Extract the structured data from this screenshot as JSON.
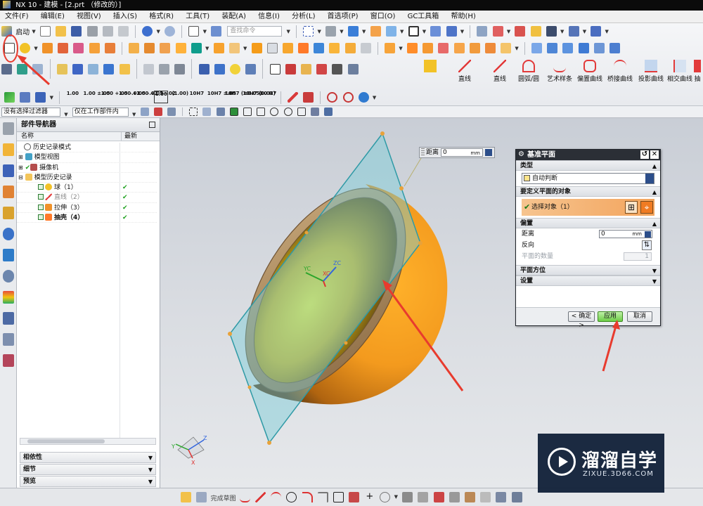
{
  "window": {
    "title": "NX 10 - 建模 - [2.prt （修改的）]"
  },
  "menubar": {
    "items": [
      "文件(F)",
      "编辑(E)",
      "视图(V)",
      "插入(S)",
      "格式(R)",
      "工具(T)",
      "装配(A)",
      "信息(I)",
      "分析(L)",
      "首选项(P)",
      "窗口(O)",
      "GC工具箱",
      "帮助(H)"
    ]
  },
  "toolbar": {
    "start_label": "启动",
    "search_placeholder": "查找命令",
    "curve_tools": [
      "直线",
      "直线",
      "圆弧/圆",
      "艺术样条",
      "偏置曲线",
      "桥接曲线",
      "投影曲线",
      "相交曲线",
      "抽"
    ],
    "unit_buttons": [
      "1.00",
      "1.00\n±.05",
      "1.00\n+.05\n-.02",
      "1.00\n+.05\n-.02",
      "1.00\n+.05\n-.02",
      "1.00",
      "(1.00)",
      "10H7",
      "10H7\n±.05",
      "10H7\n(±0.05)",
      "10H7\n(0.01)",
      "10\nH7"
    ]
  },
  "selection_bar": {
    "filter_value": "没有选择过滤器",
    "scope_value": "仅在工作部件内"
  },
  "part_navigator": {
    "title": "部件导航器",
    "col_name": "名称",
    "col_latest": "最新",
    "rows": [
      {
        "label": "历史记录模式",
        "check": false,
        "latest": ""
      },
      {
        "label": "模型视图",
        "check": false,
        "latest": ""
      },
      {
        "label": "摄像机",
        "check": true,
        "latest": ""
      },
      {
        "label": "模型历史记录",
        "check": false,
        "latest": ""
      },
      {
        "label": "球（1）",
        "check": true,
        "latest": "✔"
      },
      {
        "label": "直线（2）",
        "check": true,
        "latest": "✔"
      },
      {
        "label": "拉伸（3）",
        "check": true,
        "latest": "✔"
      },
      {
        "label": "抽壳（4）",
        "check": true,
        "latest": "✔"
      }
    ],
    "panels": [
      "相依性",
      "细节",
      "预览"
    ]
  },
  "distance_popup": {
    "label": "距离",
    "value": "0",
    "unit": "mm"
  },
  "datum_dialog": {
    "title": "基准平面",
    "type_section": "类型",
    "type_value": "自动判断",
    "objects_section": "要定义平面的对象",
    "select_object_label": "选择对象（1）",
    "offset_section": "偏置",
    "distance_label": "距离",
    "distance_value": "0",
    "distance_unit": "mm",
    "reverse_label": "反向",
    "plane_count_label": "平面的数量",
    "plane_count_value": "1",
    "orientation_section": "平面方位",
    "settings_section": "设置",
    "ok_label": "< 确定 >",
    "apply_label": "应用",
    "cancel_label": "取消"
  },
  "statusbar": {
    "finish_sketch_label": "完成草图"
  },
  "watermark": {
    "brand": "溜溜自学",
    "url": "ZIXUE.3D66.COM"
  },
  "wcs_labels": {
    "xc": "XC",
    "yc": "YC",
    "zc": "ZC"
  },
  "triad_labels": {
    "x": "X",
    "y": "Y",
    "z": "Z"
  },
  "colors": {
    "accent_orange": "#f39a1e",
    "plane_teal": "#2f9aa6",
    "arrow_red": "#e83b2e",
    "apply_green": "#6ccc45"
  }
}
